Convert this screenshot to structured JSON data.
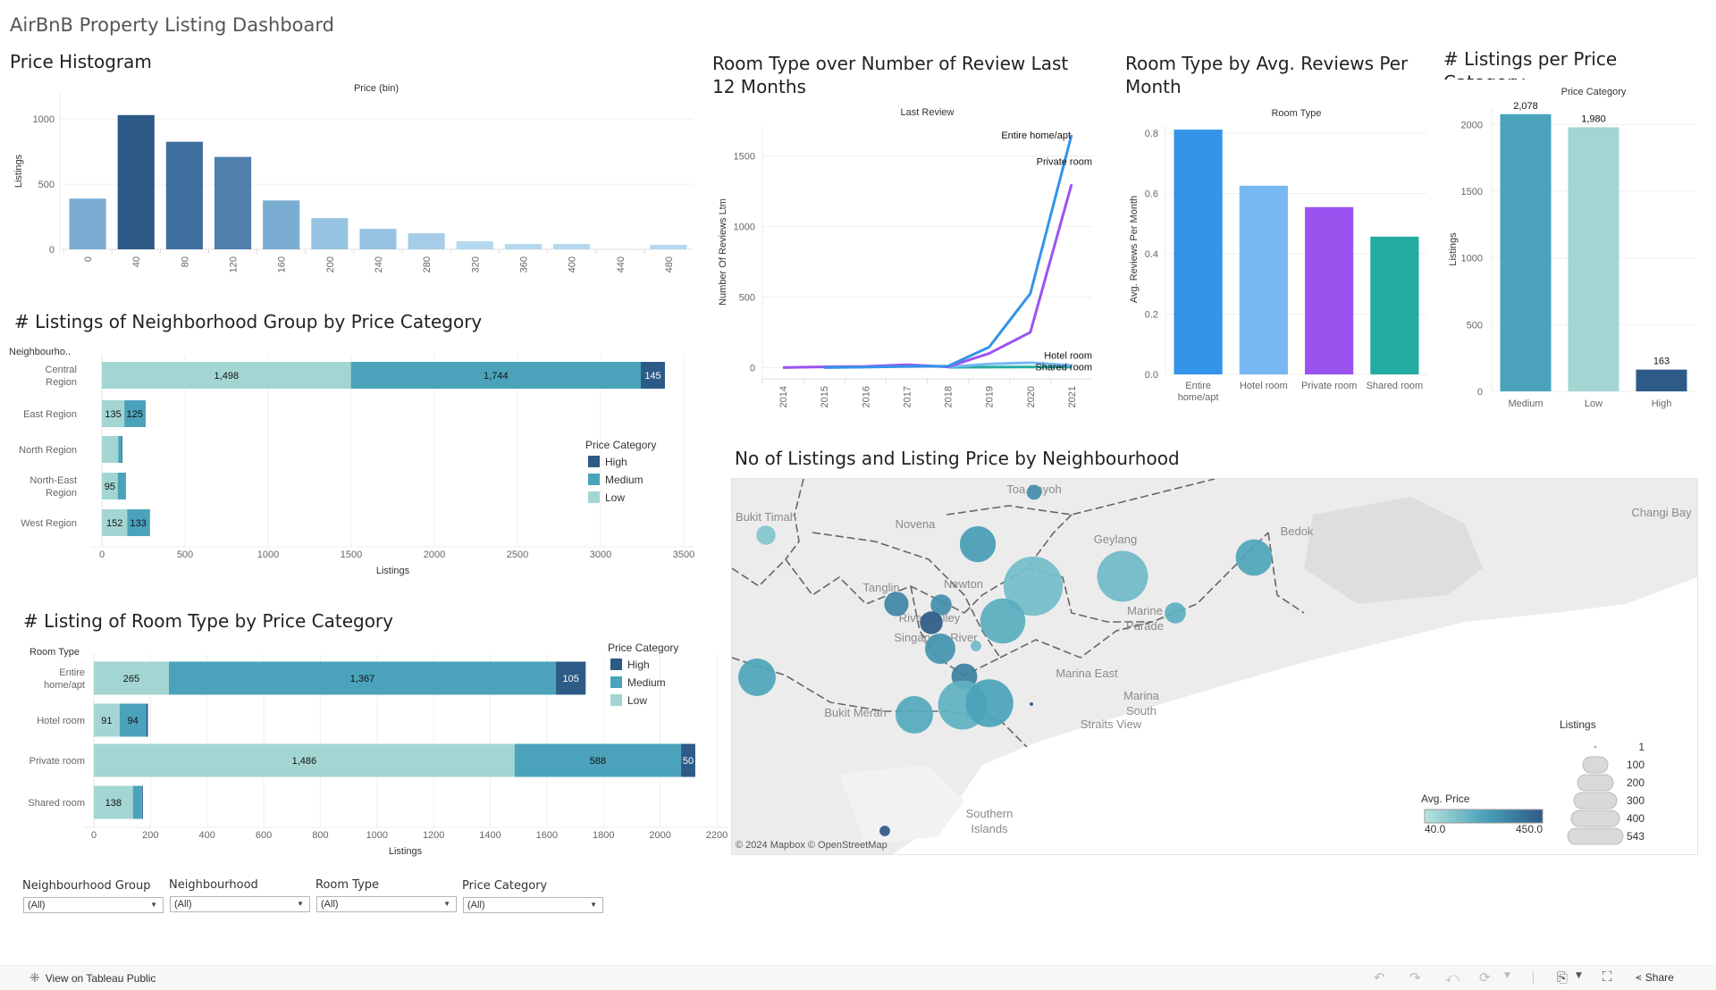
{
  "dashboard": {
    "title": "AirBnB Property Listing Dashboard"
  },
  "colors": {
    "high": "#2e5a87",
    "medium": "#4aa3ba",
    "low": "#a3d6d2",
    "entire_home": "#3394e8",
    "hotel_room": "#77b8f3",
    "private_room": "#9b53f0",
    "shared_room": "#24aba2"
  },
  "chart_data": [
    {
      "id": "price_histogram",
      "type": "bar",
      "title": "Price Histogram",
      "top_axis_title": "Price (bin)",
      "xlabel": "Price (bin)",
      "ylabel": "Listings",
      "categories": [
        "0",
        "40",
        "80",
        "120",
        "160",
        "200",
        "240",
        "280",
        "320",
        "360",
        "400",
        "440",
        "480"
      ],
      "values": [
        389,
        1030,
        825,
        709,
        375,
        239,
        157,
        123,
        61,
        41,
        41,
        0,
        34
      ],
      "yticks": [
        0,
        500,
        1000
      ],
      "ylim": [
        0,
        1200
      ],
      "grid": true
    },
    {
      "id": "room_type_reviews_ltm",
      "type": "line",
      "title": "Room Type over Number of Review Last 12 Months",
      "top_axis_title": "Last Review",
      "xlabel": "Last Review",
      "ylabel": "Number Of Reviews Ltm",
      "x": [
        "2014",
        "2015",
        "2016",
        "2017",
        "2018",
        "2019",
        "2020",
        "2021"
      ],
      "yticks": [
        0,
        500,
        1000,
        1500
      ],
      "ylim": [
        -80,
        1720
      ],
      "series": [
        {
          "name": "Entire home/apt",
          "color_key": "entire_home",
          "values": [
            null,
            0,
            3,
            8,
            10,
            145,
            525,
            1650
          ]
        },
        {
          "name": "Private room",
          "color_key": "private_room",
          "values": [
            0,
            5,
            8,
            20,
            5,
            100,
            250,
            1300
          ]
        },
        {
          "name": "Hotel room",
          "color_key": "hotel_room",
          "values": [
            null,
            null,
            null,
            null,
            5,
            25,
            35,
            15
          ]
        },
        {
          "name": "Shared room",
          "color_key": "shared_room",
          "values": [
            null,
            null,
            null,
            null,
            2,
            3,
            4,
            3
          ]
        }
      ],
      "grid": true
    },
    {
      "id": "room_type_avg_reviews",
      "type": "bar",
      "title": "Room Type by Avg. Reviews Per Month",
      "top_axis_title": "Room Type",
      "xlabel": "Room Type",
      "ylabel": "Avg. Reviews Per Month",
      "categories": [
        "Entire home/apt",
        "Hotel room",
        "Private room",
        "Shared room"
      ],
      "category_labels": [
        [
          "Entire",
          "home/apt"
        ],
        [
          "Hotel room"
        ],
        [
          "Private room"
        ],
        [
          "Shared room"
        ]
      ],
      "color_keys": [
        "entire_home",
        "hotel_room",
        "private_room",
        "shared_room"
      ],
      "values": [
        0.812,
        0.626,
        0.555,
        0.457
      ],
      "yticks": [
        "0.0",
        "0.2",
        "0.4",
        "0.6",
        "0.8"
      ],
      "ylim": [
        0,
        0.83
      ],
      "grid": true
    },
    {
      "id": "listings_per_price_category",
      "type": "bar",
      "title": "# Listings per Price Category",
      "top_axis_title": "Price Category",
      "xlabel": "Price Category",
      "ylabel": "Listings",
      "categories": [
        "Medium",
        "Low",
        "High"
      ],
      "color_keys": [
        "medium",
        "low",
        "high"
      ],
      "values": [
        2078,
        1980,
        163
      ],
      "data_labels": [
        "2,078",
        "1,980",
        "163"
      ],
      "yticks": [
        0,
        500,
        1000,
        1500,
        2000
      ],
      "ylim": [
        0,
        2130
      ],
      "grid": true
    },
    {
      "id": "neighbourhood_group_by_price",
      "type": "bar",
      "orientation": "horizontal-stacked",
      "title": "# Listings of Neighborhood Group by Price Category",
      "row_header": "Neighbourho..",
      "xlabel": "Listings",
      "categories": [
        "Central Region",
        "East Region",
        "North Region",
        "North-East Region",
        "West Region"
      ],
      "category_labels": [
        [
          "Central",
          "Region"
        ],
        [
          "East Region"
        ],
        [
          "North Region"
        ],
        [
          "North-East",
          "Region"
        ],
        [
          "West Region"
        ]
      ],
      "series": [
        {
          "name": "Low",
          "color_key": "low",
          "values": [
            1498,
            135,
            98,
            95,
            152
          ],
          "labels": [
            "1,498",
            "135",
            "",
            "95",
            "152"
          ]
        },
        {
          "name": "Medium",
          "color_key": "medium",
          "values": [
            1744,
            125,
            23,
            46,
            133
          ],
          "labels": [
            "1,744",
            "125",
            "",
            "",
            "133"
          ]
        },
        {
          "name": "High",
          "color_key": "high",
          "values": [
            145,
            2,
            2,
            3,
            3
          ],
          "labels": [
            "145",
            "",
            "",
            "",
            ""
          ]
        }
      ],
      "xticks": [
        0,
        500,
        1000,
        1500,
        2000,
        2500,
        3000,
        3500
      ],
      "xlim": [
        0,
        3500
      ],
      "legend": {
        "title": "Price Category",
        "items": [
          "High",
          "Medium",
          "Low"
        ],
        "placement": "right"
      },
      "grid": true
    },
    {
      "id": "room_type_by_price",
      "type": "bar",
      "orientation": "horizontal-stacked",
      "title": "# Listing of Room Type by Price Category",
      "row_header": "Room Type",
      "xlabel": "Listings",
      "categories": [
        "Entire home/apt",
        "Hotel room",
        "Private room",
        "Shared room"
      ],
      "category_labels": [
        [
          "Entire",
          "home/apt"
        ],
        [
          "Hotel room"
        ],
        [
          "Private room"
        ],
        [
          "Shared room"
        ]
      ],
      "series": [
        {
          "name": "Low",
          "color_key": "low",
          "values": [
            265,
            91,
            1486,
            138
          ],
          "labels": [
            "265",
            "91",
            "1,486",
            "138"
          ]
        },
        {
          "name": "Medium",
          "color_key": "medium",
          "values": [
            1367,
            94,
            588,
            32
          ],
          "labels": [
            "1,367",
            "94",
            "588",
            ""
          ]
        },
        {
          "name": "High",
          "color_key": "high",
          "values": [
            105,
            6,
            50,
            3
          ],
          "labels": [
            "105",
            "",
            "50",
            ""
          ]
        }
      ],
      "xticks": [
        0,
        200,
        400,
        600,
        800,
        1000,
        1200,
        1400,
        1600,
        1800,
        2000,
        2200
      ],
      "xlim": [
        0,
        2200
      ],
      "legend": {
        "title": "Price Category",
        "items": [
          "High",
          "Medium",
          "Low"
        ],
        "placement": "top-right"
      },
      "grid": true
    }
  ],
  "map": {
    "title": "No of Listings and Listing Price by Neighbourhood",
    "attribution": "© 2024 Mapbox  © OpenStreetMap",
    "place_labels": [
      "Toa Payoh",
      "Bukit Timah",
      "Novena",
      "Geylang",
      "Bedok",
      "Changi Bay",
      "Tanglin",
      "Newton",
      "River Valley",
      "Singapore River",
      "Marine Parade",
      "Marina East",
      "Marina South",
      "Bukit Merah",
      "Straits View",
      "Southern Islands"
    ],
    "color_legend": {
      "title": "Avg. Price",
      "min": "40.0",
      "max": "450.0"
    },
    "size_legend": {
      "title": "Listings",
      "items": [
        "1",
        "100",
        "200",
        "300",
        "400",
        "543"
      ]
    },
    "bubbles": [
      {
        "near": "Toa Payoh",
        "price_level": 0.65,
        "listings_level": 0.06
      },
      {
        "near": "Bukit Timah",
        "price_level": 0.2,
        "listings_level": 0.1
      },
      {
        "near": "Novena",
        "price_level": 0.55,
        "listings_level": 0.35
      },
      {
        "near": "Kallang",
        "price_level": 0.28,
        "listings_level": 0.95
      },
      {
        "near": "Geylang",
        "price_level": 0.3,
        "listings_level": 0.7
      },
      {
        "near": "Marine Parade",
        "price_level": 0.4,
        "listings_level": 0.12
      },
      {
        "near": "Bedok",
        "price_level": 0.48,
        "listings_level": 0.36
      },
      {
        "near": "Tanglin",
        "price_level": 0.7,
        "listings_level": 0.16
      },
      {
        "near": "Newton",
        "price_level": 0.65,
        "listings_level": 0.12
      },
      {
        "near": "Orchard",
        "price_level": 1.0,
        "listings_level": 0.14
      },
      {
        "near": "River Valley",
        "price_level": 0.6,
        "listings_level": 0.25
      },
      {
        "near": "Rochor",
        "price_level": 0.42,
        "listings_level": 0.55
      },
      {
        "near": "Museum",
        "price_level": 0.3,
        "listings_level": 0.03
      },
      {
        "near": "Singapore River",
        "price_level": 0.75,
        "listings_level": 0.18
      },
      {
        "near": "Downtown Core",
        "price_level": 0.38,
        "listings_level": 0.65
      },
      {
        "near": "Outram",
        "price_level": 0.5,
        "listings_level": 0.62
      },
      {
        "near": "Bukit Merah",
        "price_level": 0.45,
        "listings_level": 0.38
      },
      {
        "near": "Queenstown",
        "price_level": 0.48,
        "listings_level": 0.38
      },
      {
        "near": "Marina South",
        "price_level": 1.0,
        "listings_level": 0.002
      },
      {
        "near": "Southern Islands",
        "price_level": 1.0,
        "listings_level": 0.03
      }
    ]
  },
  "filters": [
    {
      "label": "Neighbourhood Group",
      "value": "(All)"
    },
    {
      "label": "Neighbourhood",
      "value": "(All)"
    },
    {
      "label": "Room Type",
      "value": "(All)"
    },
    {
      "label": "Price Category",
      "value": "(All)"
    }
  ],
  "toolbar": {
    "view_on_public": "View on Tableau Public",
    "share": "Share",
    "icons": [
      "undo-icon",
      "redo-icon",
      "revert-icon",
      "refresh-icon",
      "download-icon",
      "fullscreen-icon",
      "share-icon"
    ]
  }
}
